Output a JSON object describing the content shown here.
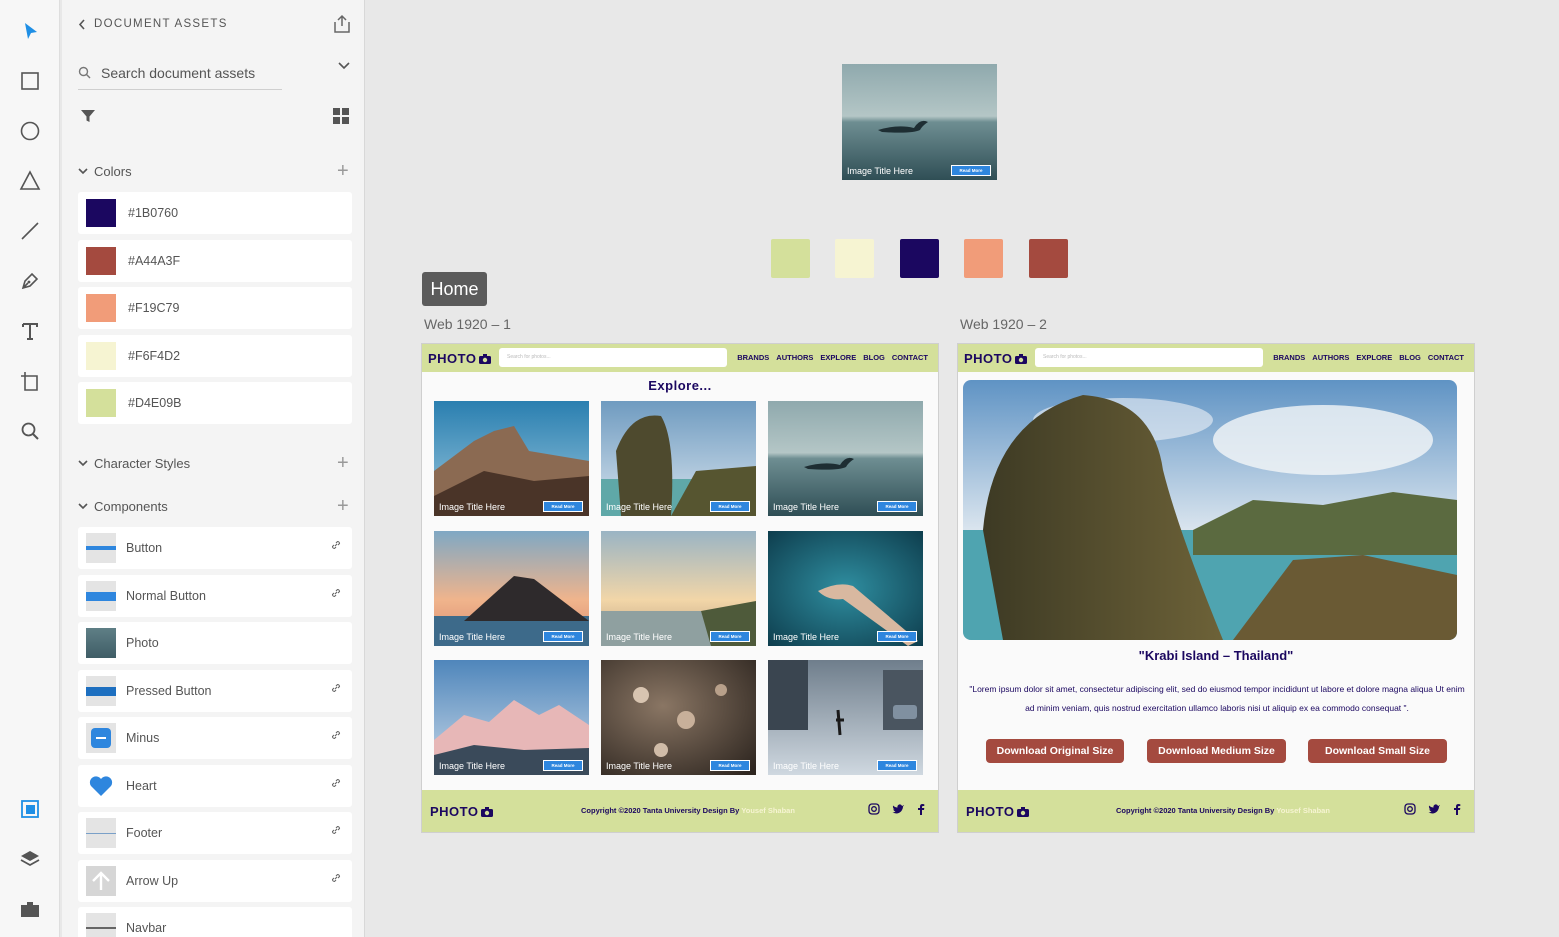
{
  "panel": {
    "title": "DOCUMENT ASSETS",
    "search_placeholder": "Search document assets",
    "colors_heading": "Colors",
    "colors": [
      {
        "label": "#1B0760",
        "hex": "#1b0760"
      },
      {
        "label": "#A44A3F",
        "hex": "#a44a3f"
      },
      {
        "label": "#F19C79",
        "hex": "#f19c79"
      },
      {
        "label": "#F6F4D2",
        "hex": "#f6f4d2"
      },
      {
        "label": "#D4E09B",
        "hex": "#d4e09b"
      }
    ],
    "character_styles_heading": "Character Styles",
    "components_heading": "Components",
    "components": [
      {
        "label": "Button",
        "icon": "button-thumb-icon",
        "linked": true
      },
      {
        "label": "Normal Button",
        "icon": "normal-button-thumb-icon",
        "linked": true
      },
      {
        "label": "Photo",
        "icon": "photo-thumb-icon",
        "linked": false
      },
      {
        "label": "Pressed Button",
        "icon": "pressed-button-thumb-icon",
        "linked": true
      },
      {
        "label": "Minus",
        "icon": "minus-thumb-icon",
        "linked": true
      },
      {
        "label": "Heart",
        "icon": "heart-icon",
        "linked": true
      },
      {
        "label": "Footer",
        "icon": "footer-thumb-icon",
        "linked": true
      },
      {
        "label": "Arrow Up",
        "icon": "arrow-up-icon",
        "linked": true
      },
      {
        "label": "Navbar",
        "icon": "navbar-thumb-icon",
        "linked": false
      }
    ]
  },
  "canvas": {
    "preview_card": {
      "title": "Image Title Here",
      "button": "Read More"
    },
    "swatches": [
      "#d4e09b",
      "#f6f4d2",
      "#1b0760",
      "#f19c79",
      "#a44a3f"
    ],
    "home_tag": "Home",
    "artboard1_name": "Web 1920 – 1",
    "artboard2_name": "Web 1920 – 2"
  },
  "site": {
    "logo": "PHOTO",
    "search_placeholder": "Search for photos...",
    "nav_links": [
      "BRANDS",
      "AUTHORS",
      "EXPLORE",
      "BLOG",
      "CONTACT"
    ],
    "explore_heading": "Explore...",
    "photo_title": "Image Title Here",
    "photo_button": "Read More",
    "copyright": "Copyright ©2020 Tanta University Design By",
    "designer": "Yousef Shaban",
    "detail_title": "\"Krabi Island – Thailand\"",
    "detail_text": "\"Lorem ipsum dolor sit amet, consectetur adipiscing elit, sed do eiusmod tempor incididunt ut labore et dolore magna aliqua Ut enim ad minim veniam, quis nostrud exercitation ullamco laboris nisi ut aliquip ex ea commodo consequat \".",
    "download_buttons": [
      "Download Original Size",
      "Download Medium Size",
      "Download Small Size"
    ]
  }
}
